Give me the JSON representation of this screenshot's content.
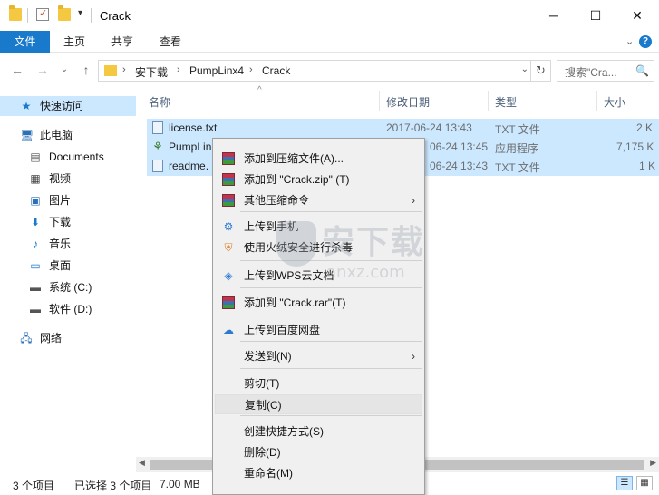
{
  "window": {
    "title": "Crack",
    "controls": {
      "minimize": "─",
      "maximize": "☐",
      "close": "✕"
    }
  },
  "ribbon": {
    "file_tab": "文件",
    "tabs": [
      "主页",
      "共享",
      "查看"
    ],
    "expand": "⌄",
    "help": "?"
  },
  "address": {
    "crumbs": [
      "安下载",
      "PumpLinx4",
      "Crack"
    ],
    "separator": "›",
    "search_placeholder": "搜索\"Cra...",
    "search_icon": "🔍",
    "refresh": "↻"
  },
  "nav": {
    "back": "←",
    "forward": "→",
    "recent": "⌄",
    "up": "↑"
  },
  "sidebar": {
    "items": [
      {
        "label": "快速访问",
        "icon": "star-icon",
        "glyph": "★",
        "color": "#1979ca"
      },
      {
        "label": "此电脑",
        "icon": "computer-icon",
        "glyph": "🖥",
        "color": "#2b6fb6"
      },
      {
        "label": "Documents",
        "icon": "documents-icon",
        "glyph": "▤",
        "color": "#555"
      },
      {
        "label": "视频",
        "icon": "video-icon",
        "glyph": "▦",
        "color": "#444"
      },
      {
        "label": "图片",
        "icon": "pictures-icon",
        "glyph": "▣",
        "color": "#2b6fb6"
      },
      {
        "label": "下载",
        "icon": "download-icon",
        "glyph": "⬇",
        "color": "#1979ca"
      },
      {
        "label": "音乐",
        "icon": "music-icon",
        "glyph": "♪",
        "color": "#1979ca"
      },
      {
        "label": "桌面",
        "icon": "desktop-icon",
        "glyph": "▭",
        "color": "#1979ca"
      },
      {
        "label": "系统 (C:)",
        "icon": "drive-c-icon",
        "glyph": "▬",
        "color": "#555"
      },
      {
        "label": "软件 (D:)",
        "icon": "drive-d-icon",
        "glyph": "▬",
        "color": "#555"
      },
      {
        "label": "网络",
        "icon": "network-icon",
        "glyph": "🖧",
        "color": "#2b6fb6"
      }
    ]
  },
  "list": {
    "sort_indicator": "^",
    "columns": [
      "名称",
      "修改日期",
      "类型",
      "大小"
    ],
    "rows": [
      {
        "name": "license.txt",
        "date": "2017-06-24 13:43",
        "type": "TXT 文件",
        "size": "2 K",
        "icon": "text-file-icon"
      },
      {
        "name": "PumpLin",
        "date": "06-24 13:45",
        "type": "应用程序",
        "size": "7,175 K",
        "icon": "app-file-icon"
      },
      {
        "name": "readme.",
        "date": "06-24 13:43",
        "type": "TXT 文件",
        "size": "1 K",
        "icon": "text-file-icon"
      }
    ]
  },
  "statusbar": {
    "count": "3 个项目",
    "selected": "已选择 3 个项目",
    "size": "7.00 MB",
    "details_view": "☰",
    "icons_view": "▦"
  },
  "context_menu": {
    "items": [
      {
        "label": "添加到压缩文件(A)...",
        "icon": "winrar-icon"
      },
      {
        "label": "添加到 \"Crack.zip\" (T)",
        "icon": "winrar-icon"
      },
      {
        "label": "其他压缩命令",
        "icon": "winrar-icon",
        "submenu": true
      },
      {
        "label": "上传到手机",
        "icon": "phone-upload-icon"
      },
      {
        "label": "使用火绒安全进行杀毒",
        "icon": "huorong-shield-icon"
      },
      {
        "label": "上传到WPS云文档",
        "icon": "wps-cloud-icon"
      },
      {
        "label": "添加到 \"Crack.rar\"(T)",
        "icon": "winrar-icon"
      },
      {
        "label": "上传到百度网盘",
        "icon": "baidu-cloud-icon"
      },
      {
        "label": "发送到(N)",
        "icon": "",
        "submenu": true
      },
      {
        "label": "剪切(T)",
        "icon": ""
      },
      {
        "label": "复制(C)",
        "icon": ""
      },
      {
        "label": "创建快捷方式(S)",
        "icon": ""
      },
      {
        "label": "删除(D)",
        "icon": ""
      },
      {
        "label": "重命名(M)",
        "icon": ""
      }
    ],
    "submenu_arrow": "›",
    "highlighted": "复制(C)"
  },
  "watermark": {
    "logo_text": "安下载",
    "sub_text": "anxz.com"
  }
}
